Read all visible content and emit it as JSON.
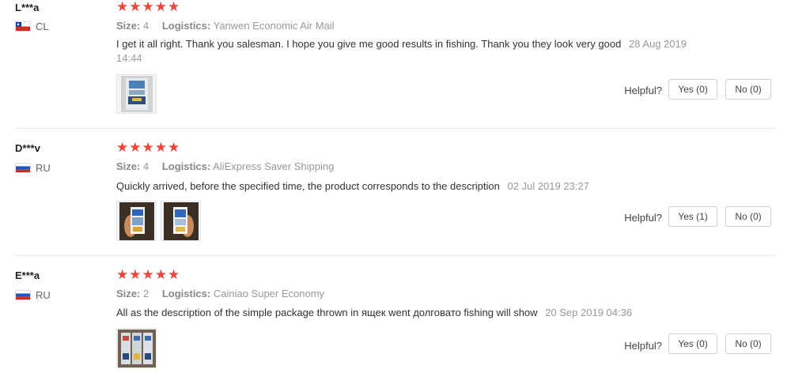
{
  "helpful_label": "Helpful?",
  "size_label": "Size:",
  "logistics_label": "Logistics:",
  "star_glyph": "★",
  "reviews": [
    {
      "username": "L***a",
      "country": "CL",
      "flag": "chile-flag",
      "stars": 5,
      "size": "4",
      "logistics": "Yanwen Economic Air Mail",
      "text": "I get it all right. Thank you salesman. I hope you give me good results in fishing. Thank you they look very good",
      "date": "28 Aug 2019 14:44",
      "photos": [
        "product-photo"
      ],
      "yes": "Yes (0)",
      "no": "No (0)"
    },
    {
      "username": "D***v",
      "country": "RU",
      "flag": "russia-flag",
      "stars": 5,
      "size": "4",
      "logistics": "AliExpress Saver Shipping",
      "text": "Quickly arrived, before the specified time, the product corresponds to the description",
      "date": "02 Jul 2019 23:27",
      "photos": [
        "product-photo",
        "product-photo"
      ],
      "yes": "Yes (1)",
      "no": "No (0)"
    },
    {
      "username": "E***a",
      "country": "RU",
      "flag": "russia-flag",
      "stars": 5,
      "size": "2",
      "logistics": "Cainiao Super Economy",
      "text": "All as the description of the simple package thrown in ящек went долговато fishing will show",
      "date": "20 Sep 2019 04:36",
      "photos": [
        "product-photo"
      ],
      "yes": "Yes (0)",
      "no": "No (0)"
    }
  ]
}
